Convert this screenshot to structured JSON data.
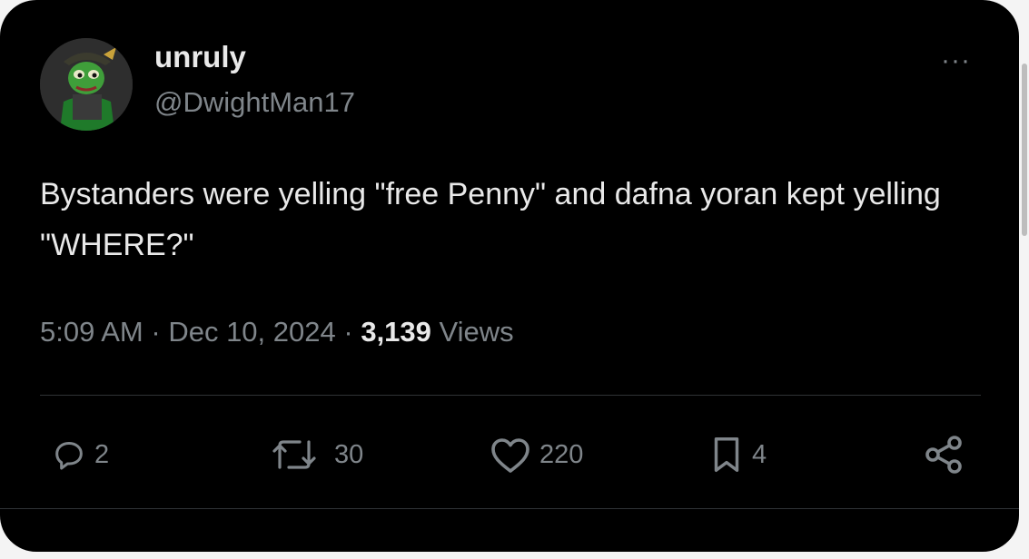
{
  "tweet": {
    "display_name": "unruly",
    "handle": "@DwightMan17",
    "text": "Bystanders were yelling \"free Penny\" and dafna yoran kept yelling \"WHERE?\"",
    "time": "5:09 AM",
    "separator": "·",
    "date": "Dec 10, 2024",
    "views_count": "3,139",
    "views_label": "Views",
    "more_label": "···"
  },
  "actions": {
    "reply_count": "2",
    "retweet_count": "30",
    "like_count": "220",
    "bookmark_count": "4"
  },
  "icons": {
    "reply": "reply-icon",
    "retweet": "retweet-icon",
    "like": "heart-icon",
    "bookmark": "bookmark-icon",
    "share": "share-icon",
    "more": "more-icon",
    "avatar": "frog-avatar"
  },
  "colors": {
    "background": "#000000",
    "primary_text": "#e9e9e9",
    "secondary_text": "#7f858a",
    "divider": "#2f3336"
  }
}
